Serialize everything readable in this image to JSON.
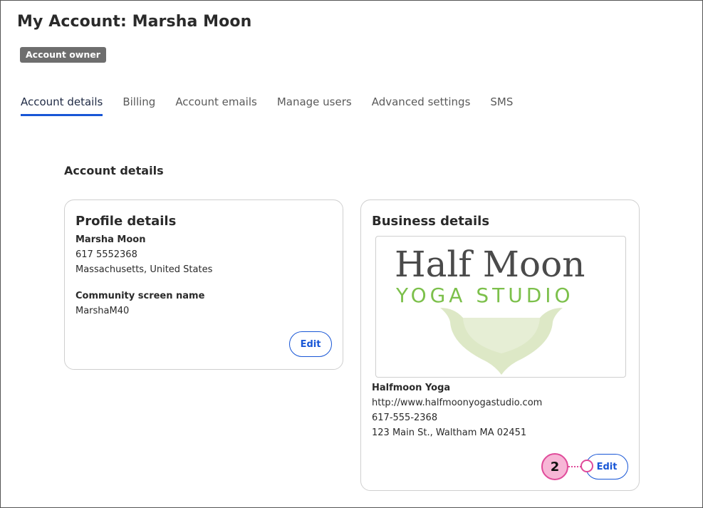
{
  "header": {
    "title": "My Account: Marsha Moon",
    "badge": "Account owner"
  },
  "tabs": [
    {
      "label": "Account details",
      "active": true
    },
    {
      "label": "Billing",
      "active": false
    },
    {
      "label": "Account emails",
      "active": false
    },
    {
      "label": "Manage users",
      "active": false
    },
    {
      "label": "Advanced settings",
      "active": false
    },
    {
      "label": "SMS",
      "active": false
    }
  ],
  "section": {
    "title": "Account details"
  },
  "profile": {
    "title": "Profile details",
    "name": "Marsha Moon",
    "phone": "617 5552368",
    "location": "Massachusetts, United States",
    "screen_name_label": "Community screen name",
    "screen_name": "MarshaM40",
    "edit_label": "Edit"
  },
  "business": {
    "title": "Business details",
    "logo": {
      "line1": "Half Moon",
      "line2": "YOGA STUDIO"
    },
    "name": "Halfmoon Yoga",
    "website": "http://www.halfmoonyogastudio.com",
    "phone": "617-555-2368",
    "address": "123 Main St., Waltham MA 02451",
    "edit_label": "Edit"
  },
  "callout": {
    "number": "2"
  },
  "colors": {
    "accent": "#1856d6",
    "badge_bg": "#6e6e6e",
    "callout_pink": "#e04b9a",
    "logo_green": "#7cc04b",
    "logo_gray": "#4a4a4a"
  }
}
